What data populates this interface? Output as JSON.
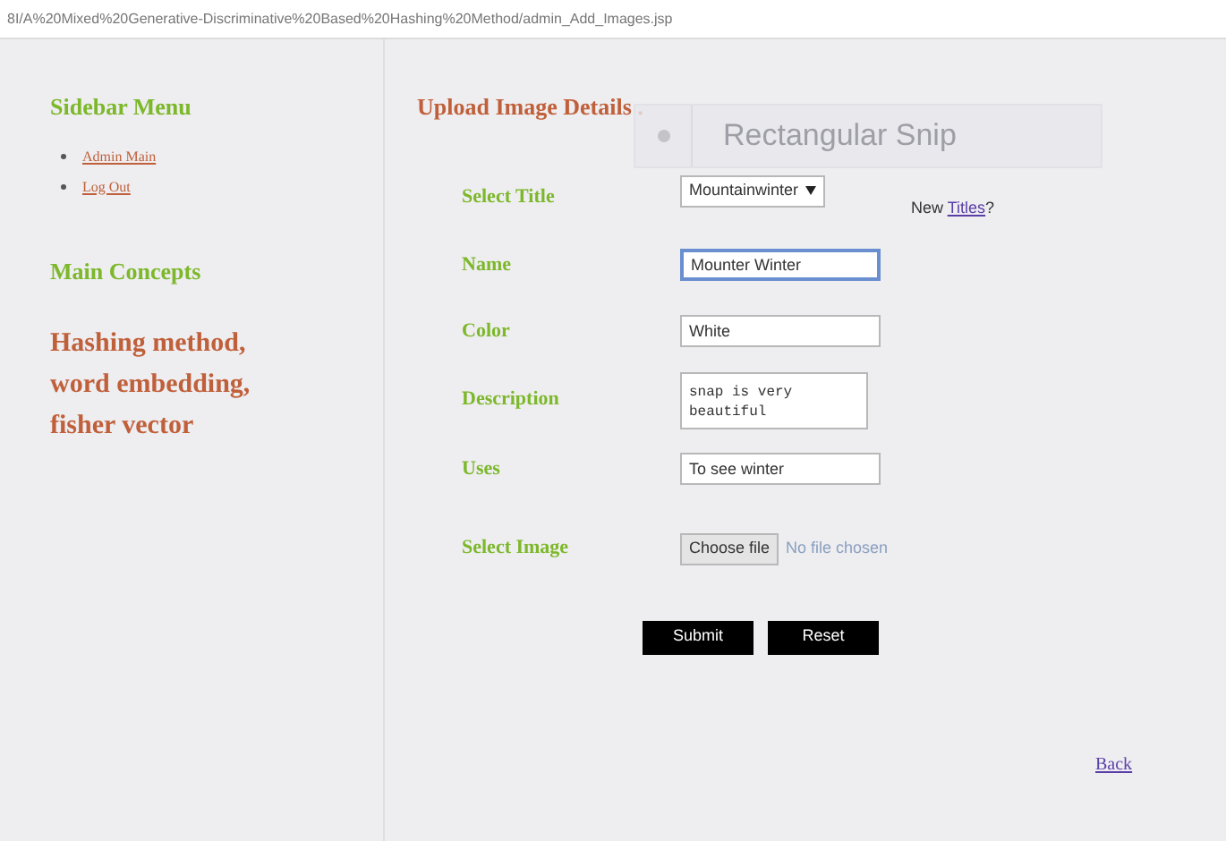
{
  "address_bar": {
    "url": "8I/A%20Mixed%20Generative-Discriminative%20Based%20Hashing%20Method/admin_Add_Images.jsp"
  },
  "sidebar": {
    "menu_title": "Sidebar Menu",
    "links": [
      "Admin Main",
      "Log Out"
    ],
    "concepts_title": "Main Concepts",
    "concepts": "Hashing method, word embedding, fisher vector"
  },
  "main": {
    "title": "Upload Image Details .",
    "fields": [
      {
        "label": "Select Title",
        "kind": "select",
        "value": "Mountainwinter",
        "focused": false,
        "note": "New ",
        "note_link": "Titles",
        "note_end": "?"
      },
      {
        "label": "Name",
        "kind": "text",
        "value": "Mounter Winter",
        "focused": true
      },
      {
        "label": "Color",
        "kind": "text",
        "value": "White",
        "focused": false
      },
      {
        "label": "Description",
        "kind": "textarea",
        "value": "snap is very beautiful",
        "focused": false
      },
      {
        "label": "Uses",
        "kind": "text",
        "value": "To see winter",
        "focused": false
      },
      {
        "label": "Select Image",
        "kind": "file",
        "button": "Choose file",
        "value": "No file chosen",
        "focused": false
      }
    ],
    "buttons": [
      "Submit",
      "Reset"
    ],
    "back_link": "Back"
  },
  "snip_overlay": {
    "label": "Rectangular Snip"
  }
}
